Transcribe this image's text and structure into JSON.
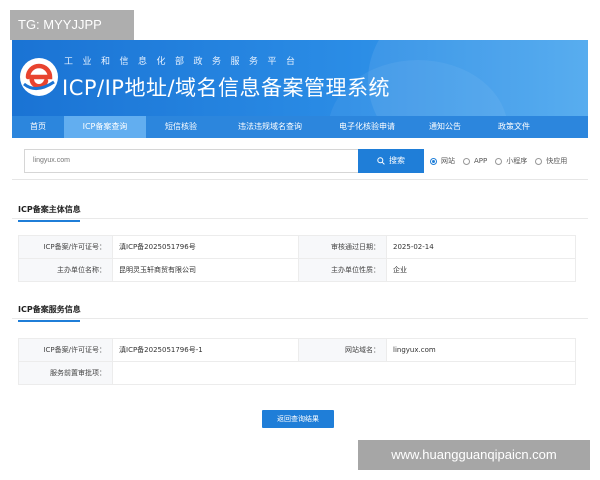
{
  "overlay_tag": "TG: MYYJJPP",
  "header": {
    "subtitle": "工业和信息化部政务服务平台",
    "title": "ICP/IP地址/域名信息备案管理系统"
  },
  "nav": {
    "items": [
      {
        "label": "首页",
        "active": false
      },
      {
        "label": "ICP备案查询",
        "active": true
      },
      {
        "label": "短信核验",
        "active": false
      },
      {
        "label": "违法违规域名查询",
        "active": false
      },
      {
        "label": "电子化核验申请",
        "active": false
      },
      {
        "label": "通知公告",
        "active": false
      },
      {
        "label": "政策文件",
        "active": false
      }
    ]
  },
  "search": {
    "value": "lingyux.com",
    "button_label": "搜索",
    "options": [
      {
        "label": "网站",
        "selected": true
      },
      {
        "label": "APP",
        "selected": false
      },
      {
        "label": "小程序",
        "selected": false
      },
      {
        "label": "快应用",
        "selected": false
      }
    ]
  },
  "subject_section": {
    "title": "ICP备案主体信息",
    "rows": [
      {
        "label1": "ICP备案/许可证号：",
        "value1": "滇ICP备2025051796号",
        "label2": "审核通过日期：",
        "value2": "2025-02-14"
      },
      {
        "label1": "主办单位名称：",
        "value1": "昆明灵玉轩商贸有限公司",
        "label2": "主办单位性质：",
        "value2": "企业"
      }
    ]
  },
  "service_section": {
    "title": "ICP备案服务信息",
    "row1": {
      "label1": "ICP备案/许可证号：",
      "value1": "滇ICP备2025051796号-1",
      "label2": "网站域名：",
      "value2": "lingyux.com"
    },
    "row2": {
      "label1": "服务前置审批项：",
      "value1": ""
    }
  },
  "return_button": "返回查询结果",
  "watermark": "www.huangguanqipaicn.com",
  "colors": {
    "primary": "#1f7ed8",
    "nav_bg": "#2c86dd",
    "nav_active": "#62aef0"
  }
}
